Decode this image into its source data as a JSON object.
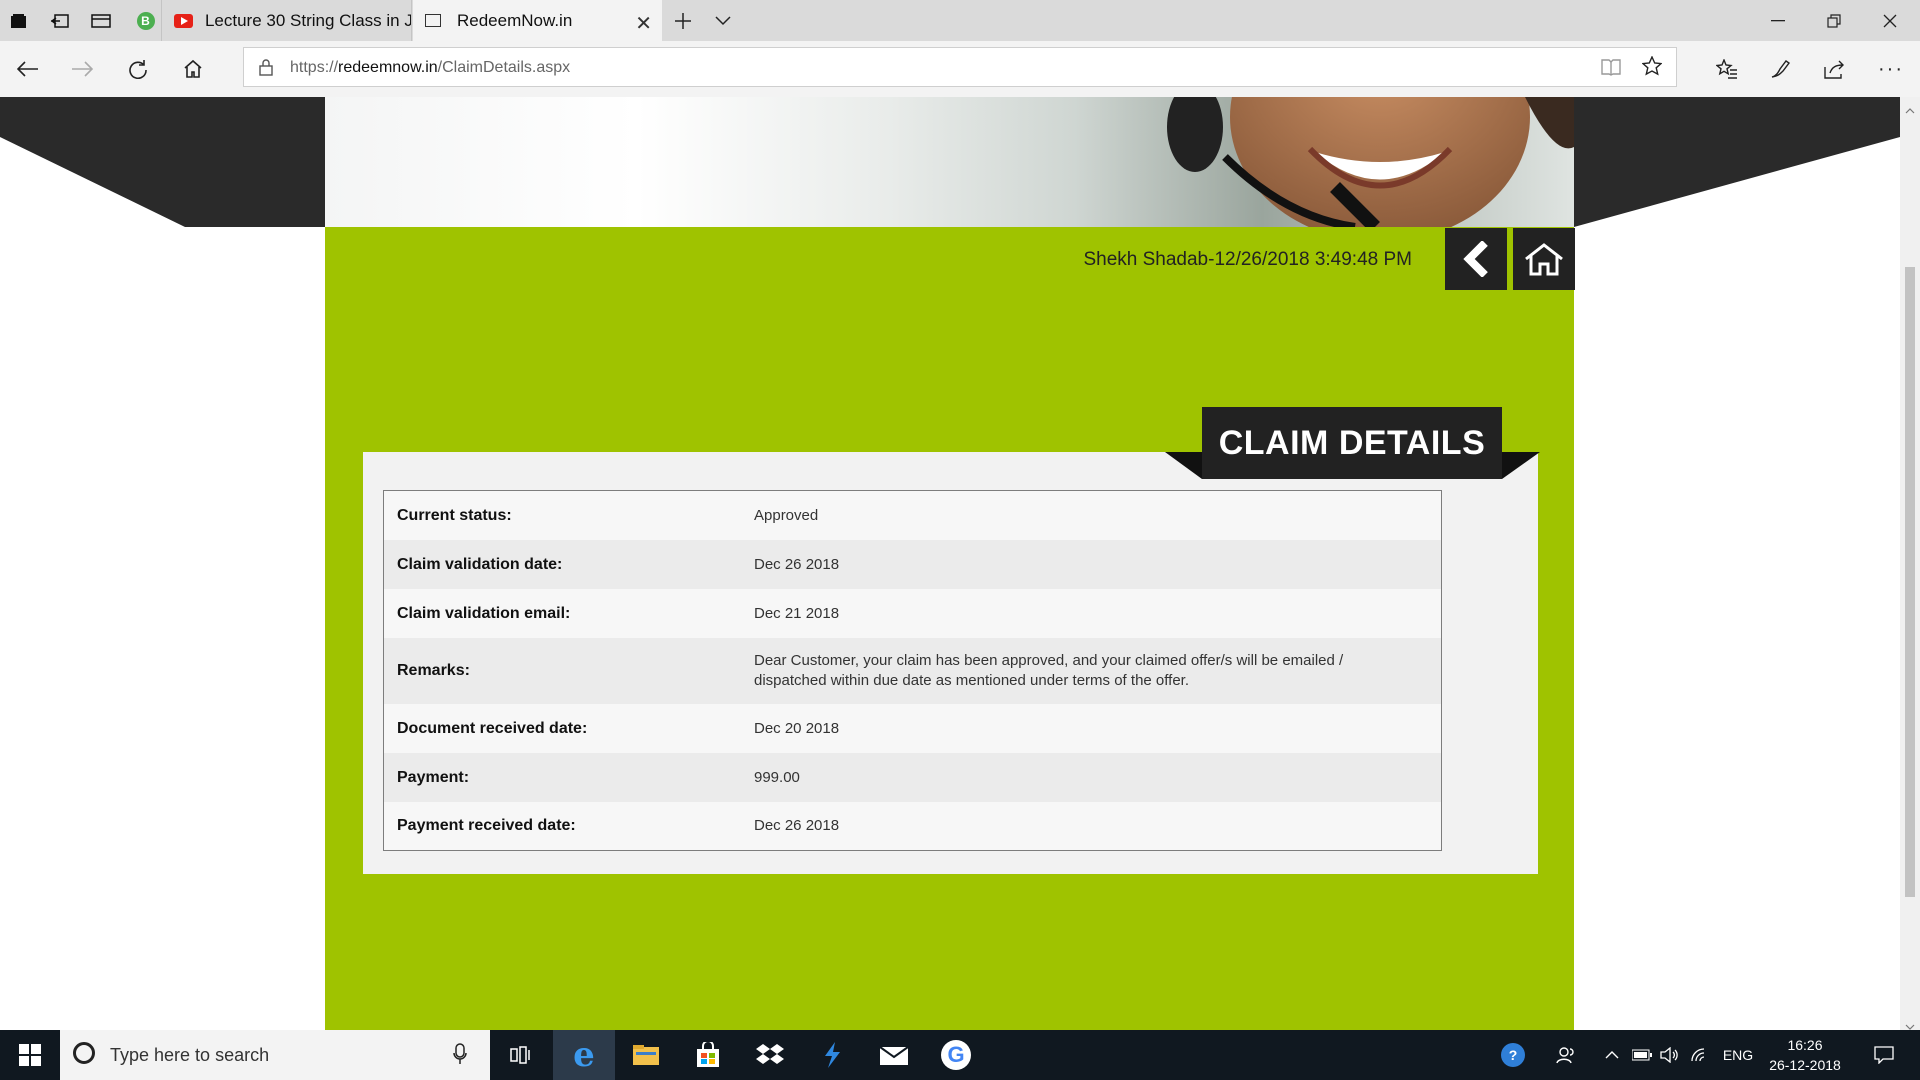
{
  "browser": {
    "tabs": [
      {
        "title": "Lecture 30 String Class in Ja",
        "icon": "youtube-icon",
        "active": false
      },
      {
        "title": "RedeemNow.in",
        "icon": "page-icon",
        "active": true
      }
    ],
    "address": {
      "scheme": "https://",
      "host": "redeemnow.in",
      "path": "/ClaimDetails.aspx"
    }
  },
  "page": {
    "user_line": "Shekh Shadab-12/26/2018 3:49:48 PM",
    "section_title": "CLAIM DETAILS",
    "rows": [
      {
        "label": "Current status:",
        "value": "Approved"
      },
      {
        "label": "Claim validation date:",
        "value": "Dec 26 2018"
      },
      {
        "label": "Claim validation email:",
        "value": "Dec 21 2018"
      },
      {
        "label": "Remarks:",
        "value": "Dear Customer, your claim has been approved, and your claimed offer/s will be emailed / dispatched within due date as mentioned under terms of the offer."
      },
      {
        "label": "Document received date:",
        "value": "Dec 20 2018"
      },
      {
        "label": "Payment:",
        "value": "999.00"
      },
      {
        "label": "Payment received date:",
        "value": "Dec 26 2018"
      }
    ],
    "colors": {
      "accent_green": "#9fc300",
      "dark": "#222222"
    }
  },
  "taskbar": {
    "search_placeholder": "Type here to search",
    "language": "ENG",
    "time": "16:26",
    "date": "26-12-2018"
  }
}
